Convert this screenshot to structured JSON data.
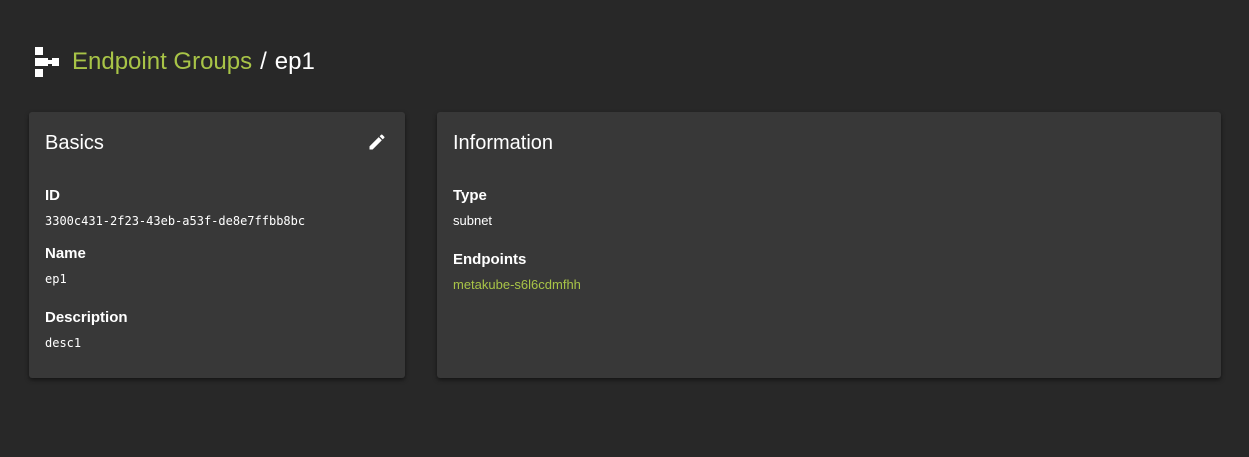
{
  "breadcrumb": {
    "parent": "Endpoint Groups",
    "separator": "/",
    "current": "ep1"
  },
  "basics": {
    "title": "Basics",
    "fields": [
      {
        "label": "ID",
        "value": "3300c431-2f23-43eb-a53f-de8e7ffbb8bc"
      },
      {
        "label": "Name",
        "value": "ep1"
      },
      {
        "label": "Description",
        "value": "desc1"
      }
    ]
  },
  "information": {
    "title": "Information",
    "type_label": "Type",
    "type_value": "subnet",
    "endpoints_label": "Endpoints",
    "endpoints": [
      "metakube-s6l6cdmfhh"
    ]
  },
  "icons": {
    "header": "endpoint-group-icon",
    "edit": "pencil-icon"
  },
  "colors": {
    "background": "#282828",
    "card": "#383838",
    "accent": "#a8c447",
    "text": "#ffffff"
  }
}
